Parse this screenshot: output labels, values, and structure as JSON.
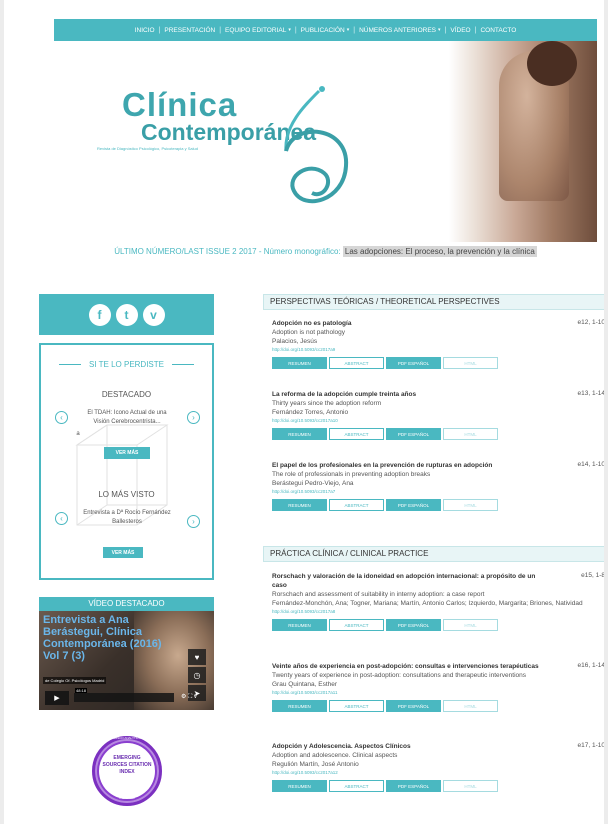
{
  "nav": {
    "items": [
      {
        "label": "INICIO",
        "dropdown": false
      },
      {
        "label": "PRESENTACIÓN",
        "dropdown": false
      },
      {
        "label": "EQUIPO EDITORIAL",
        "dropdown": true
      },
      {
        "label": "PUBLICACIÓN",
        "dropdown": true
      },
      {
        "label": "NÚMEROS ANTERIORES",
        "dropdown": true
      },
      {
        "label": "VÍDEO",
        "dropdown": false
      },
      {
        "label": "CONTACTO",
        "dropdown": false
      }
    ]
  },
  "header": {
    "logo_word1": "Clínica",
    "logo_word2": "Contemporánea",
    "logo_tagline": "Revista de Diagnóstico Psicológico, Psicoterapia y Salud"
  },
  "issue": {
    "label": "ÚLTIMO NÚMERO/LAST ISSUE 2 2017",
    "sub": " - Número monográfico: ",
    "title": "Las adopciones: El proceso, la prevención y la clínica"
  },
  "sidebar": {
    "social": [
      {
        "icon": "facebook-icon",
        "glyph": "f"
      },
      {
        "icon": "twitter-icon",
        "glyph": "t"
      },
      {
        "icon": "vimeo-icon",
        "glyph": "v"
      }
    ],
    "box_title": "SI TE LO PERDISTE",
    "destacado_label": "DESTACADO",
    "destacado_text": "El TDAH: Icono Actual de una Visión Cerebrocentrista...",
    "destacado_extra": "a",
    "vermas_1": "VER MÁS",
    "masvisto_label": "LO MÁS VISTO",
    "masvisto_text": "Entrevista a Dª Rocío Fernández Ballesteros",
    "vermas_2": "VER MÁS",
    "video_label": "VÍDEO DESTACADO",
    "video_title": "Entrevista a Ana Berástegui, Clínica Contemporánea (2016) Vol 7 (3)",
    "video_byline": "de Colegio Of. Psicólogos Madrid",
    "video_time": "48:18",
    "badge_top": "EBSCO ANALYTICS",
    "badge_text": "EMERGING SOURCES CITATION INDEX",
    "badge_bottom": "INDEXED"
  },
  "sections": [
    {
      "title": "PERSPECTIVAS TEÓRICAS / THEORETICAL PERSPECTIVES",
      "articles": [
        {
          "title": "Adopción no es patología",
          "subtitle": "Adoption is not pathology",
          "authors": "Palacios, Jesús",
          "doi": "http://doi.org/10.5093/cc2017a9",
          "pages": "e12, 1-10"
        },
        {
          "title": "La reforma de la adopción cumple treinta años",
          "subtitle": "Thirty years since the adoption reform",
          "authors": "Fernández Torres, Antonio",
          "doi": "http://doi.org/10.5093/cc2017a10",
          "pages": "e13, 1-14"
        },
        {
          "title": "El papel de los profesionales en la prevención de rupturas en adopción",
          "subtitle": "The role of professionals in preventing adoption breaks",
          "authors": "Berástegui Pedro-Viejo, Ana",
          "doi": "http://doi.org/10.5093/cc2017a7",
          "pages": "e14, 1-10"
        }
      ]
    },
    {
      "title": "PRÁCTICA CLÍNICA / CLINICAL PRACTICE",
      "articles": [
        {
          "title": "Rorschach y valoración de la idoneidad en adopción internacional: a propósito de un caso",
          "subtitle": "Rorschach and assessment of suitability in interny adoption: a case report",
          "authors": "Fernández-Monchón, Ana; Togner, Mariana; Martín, Antonio Carlos; Izquierdo, Margarita; Briones, Natividad",
          "doi": "http://doi.org/10.5093/cc2017a8",
          "pages": "e15, 1-8"
        },
        {
          "title": "Veinte años de experiencia en post-adopción: consultas e intervenciones terapéuticas",
          "subtitle": "Twenty years of experience in post-adoption: consultations and therapeutic interventions",
          "authors": "Grau Quintana, Esther",
          "doi": "http://doi.org/10.5093/cc2017a11",
          "pages": "e16, 1-14"
        },
        {
          "title": "Adopción y Adolescencia. Aspectos Clínicos",
          "subtitle": "Adoption and adolescence. Clinical aspects",
          "authors": "Regulión Martín, José Antonio",
          "doi": "http://doi.org/10.5093/cc2017a12",
          "pages": "e17, 1-10"
        }
      ]
    }
  ],
  "buttons": {
    "resumen": "RESUMEN",
    "abstract": "ABSTRACT",
    "pdf": "PDF ESPAÑOL",
    "html": "HTML"
  },
  "colors": {
    "accent": "#4ab8c1",
    "accent_light": "#e8f5f6"
  }
}
